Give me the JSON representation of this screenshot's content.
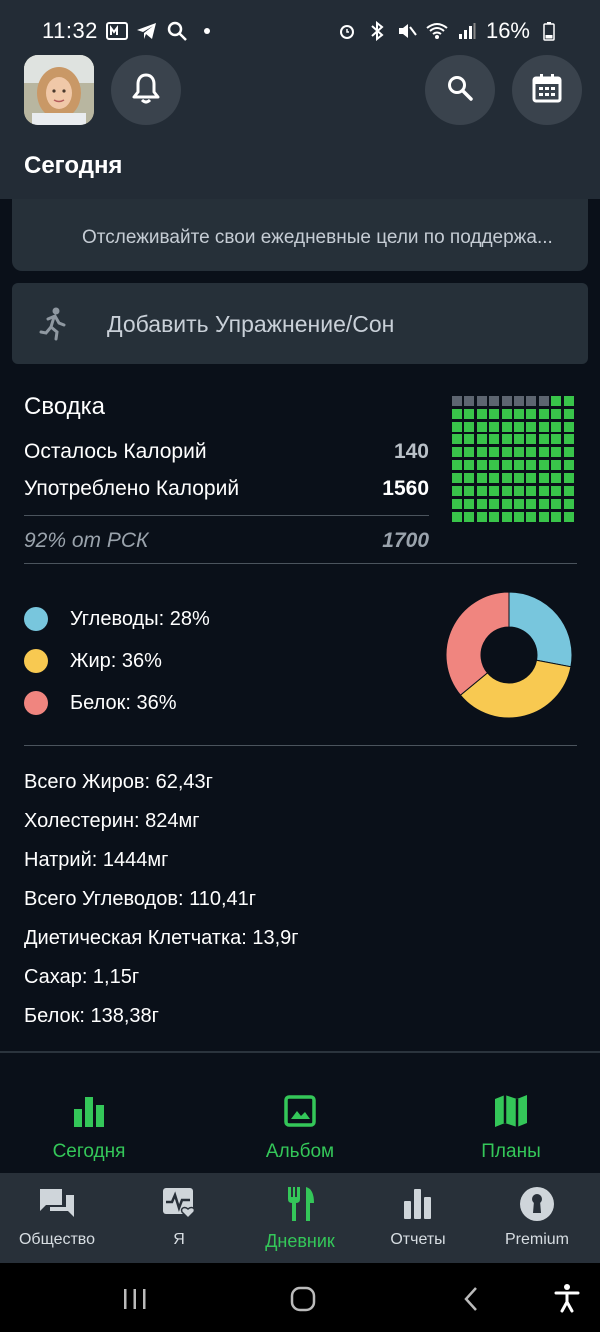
{
  "status_bar": {
    "time": "11:32",
    "battery": "16%"
  },
  "header": {
    "title": "Сегодня"
  },
  "water_card": {
    "subtitle": "Отслеживайте свои ежедневные цели по поддержа..."
  },
  "exercise_card": {
    "label": "Добавить Упражнение/Сон",
    "icon": "running-icon"
  },
  "summary": {
    "title": "Сводка",
    "rows": [
      {
        "label": "Осталось Калорий",
        "value": "140"
      },
      {
        "label": "Употреблено Калорий",
        "value": "1560"
      },
      {
        "label": "92% от РСК",
        "value": "1700"
      }
    ],
    "waffle": {
      "filled_fraction": 0.92,
      "filled_color": "#39c44a",
      "empty_color": "#5d6570"
    }
  },
  "macros": {
    "items": [
      {
        "label": "Углеводы: 28%",
        "percent": 28,
        "color": "#78c6dd"
      },
      {
        "label": "Жир: 36%",
        "percent": 36,
        "color": "#f8c951"
      },
      {
        "label": "Белок: 36%",
        "percent": 36,
        "color": "#f0857f"
      }
    ]
  },
  "nutrients": [
    "Всего Жиров: 62,43г",
    "Холестерин: 824мг",
    "Натрий: 1444мг",
    "Всего Углеводов: 110,41г",
    "Диетическая Клетчатка: 13,9г",
    "Сахар: 1,15г",
    "Белок: 138,38г"
  ],
  "sub_nav": [
    {
      "label": "Сегодня",
      "icon": "bar-chart-icon"
    },
    {
      "label": "Альбом",
      "icon": "image-icon"
    },
    {
      "label": "Планы",
      "icon": "map-icon"
    }
  ],
  "tab_bar": [
    {
      "label": "Общество",
      "icon": "chat-icon",
      "active": false
    },
    {
      "label": "Я",
      "icon": "health-icon",
      "active": false
    },
    {
      "label": "Дневник",
      "icon": "fork-knife-icon",
      "active": true
    },
    {
      "label": "Отчеты",
      "icon": "bar-chart-icon",
      "active": false
    },
    {
      "label": "Premium",
      "icon": "keyhole-icon",
      "active": false
    }
  ],
  "colors": {
    "accent": "#34c759",
    "background": "#0a1019",
    "card": "#263039"
  }
}
